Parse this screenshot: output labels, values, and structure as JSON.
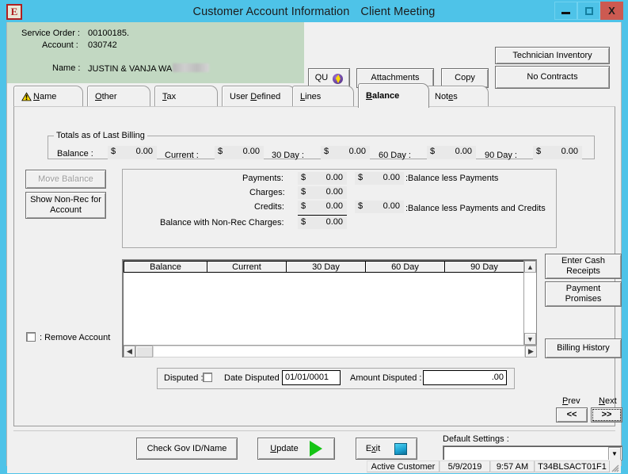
{
  "window": {
    "app_icon_letter": "E",
    "title": "Customer Account Information",
    "subtitle": "Client Meeting",
    "minimize_label": "minimize",
    "maximize_label": "maximize",
    "close_label": "X"
  },
  "header": {
    "service_order_label": "Service Order :",
    "service_order_value": "00100185.",
    "account_label": "Account :",
    "account_value": "030742",
    "name_label": "Name :",
    "name_value": "JUSTIN & VANJA WA",
    "buttons": {
      "qu": "QU",
      "attachments": "Attachments",
      "copy": "Copy",
      "technician_inventory": "Technician Inventory",
      "no_contracts": "No Contracts"
    }
  },
  "tabs": [
    {
      "label": "Name",
      "accel": "N",
      "active": false,
      "warning": true
    },
    {
      "label": "Other",
      "accel": "O",
      "active": false,
      "warning": false
    },
    {
      "label": "Tax",
      "accel": "T",
      "active": false,
      "warning": false
    },
    {
      "label": "User Defined",
      "accel": "D",
      "active": false,
      "warning": false
    },
    {
      "label": "Lines",
      "accel": "L",
      "active": false,
      "warning": false
    },
    {
      "label": "Balance",
      "accel": "B",
      "active": true,
      "warning": false
    },
    {
      "label": "Notes",
      "accel": "e",
      "active": false,
      "warning": false
    }
  ],
  "totals": {
    "group_title": "Totals as of Last Billing",
    "items": [
      {
        "label": "Balance :",
        "currency": "$",
        "amount": "0.00"
      },
      {
        "label": "Current :",
        "currency": "$",
        "amount": "0.00"
      },
      {
        "label": "30 Day :",
        "currency": "$",
        "amount": "0.00"
      },
      {
        "label": "60 Day :",
        "currency": "$",
        "amount": "0.00"
      },
      {
        "label": "90 Day :",
        "currency": "$",
        "amount": "0.00"
      }
    ]
  },
  "left_buttons": {
    "move_balance": "Move Balance",
    "move_balance_disabled": true,
    "show_non_rec": "Show Non-Rec for Account"
  },
  "summary": {
    "rows": [
      {
        "label": "Payments:",
        "currency": "$",
        "amount": "0.00"
      },
      {
        "label": "Charges:",
        "currency": "$",
        "amount": "0.00"
      },
      {
        "label": "Credits:",
        "currency": "$",
        "amount": "0.00"
      },
      {
        "label": "Balance with Non-Rec Charges:",
        "currency": "$",
        "amount": "0.00"
      }
    ],
    "derived": [
      {
        "currency": "$",
        "amount": "0.00",
        "label": ":Balance less Payments"
      },
      {
        "currency": "$",
        "amount": "0.00",
        "label": ":Balance less Payments and Credits"
      }
    ]
  },
  "grid": {
    "columns": [
      "Balance",
      "Current",
      "30 Day",
      "60 Day",
      "90 Day"
    ],
    "rows": []
  },
  "right_buttons": {
    "enter_cash_receipts": "Enter Cash Receipts",
    "payment_promises": "Payment Promises",
    "billing_history": "Billing History"
  },
  "remove_account": {
    "label": ": Remove Account",
    "checked": false
  },
  "disputed": {
    "disputed_label": "Disputed :",
    "disputed_checked": false,
    "date_label": "Date Disputed :",
    "date_value": "01/01/0001",
    "amount_label": "Amount Disputed :",
    "amount_value": ".00"
  },
  "nav": {
    "prev_label": "Prev",
    "prev_accel": "P",
    "prev_glyph": "<<",
    "next_label": "Next",
    "next_accel": "N",
    "next_glyph": ">>"
  },
  "footer": {
    "check_gov": "Check Gov ID/Name",
    "update": "Update",
    "update_accel": "U",
    "exit": "Exit",
    "exit_accel": "x",
    "default_settings_label": "Default Settings :",
    "default_settings_value": ""
  },
  "status": {
    "state": "Active Customer",
    "date": "5/9/2019",
    "time": "9:57 AM",
    "terminal": "T34BLSACT01F1"
  },
  "colors": {
    "titlebar": "#4ec3e8",
    "close_button": "#cc5a51",
    "info_panel": "#c2d8c2",
    "face": "#f0f0f0",
    "field": "#e9e9e9"
  }
}
